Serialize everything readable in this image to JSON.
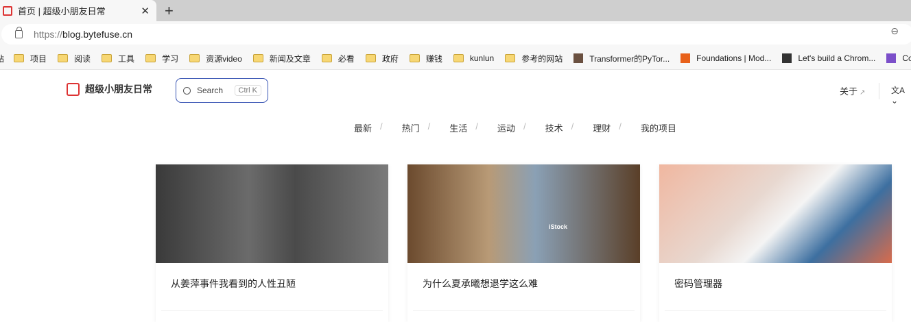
{
  "browser": {
    "tab_title": "首页 | 超级小朋友日常",
    "url_scheme": "https://",
    "url_host": "blog.bytefuse.cn",
    "bookmarks": [
      {
        "label": "项目",
        "type": "folder"
      },
      {
        "label": "阅读",
        "type": "folder"
      },
      {
        "label": "工具",
        "type": "folder"
      },
      {
        "label": "学习",
        "type": "folder"
      },
      {
        "label": "资源video",
        "type": "folder"
      },
      {
        "label": "新闻及文章",
        "type": "folder"
      },
      {
        "label": "必看",
        "type": "folder"
      },
      {
        "label": "政府",
        "type": "folder"
      },
      {
        "label": "赚钱",
        "type": "folder"
      },
      {
        "label": "kunlun",
        "type": "folder"
      },
      {
        "label": "参考的网站",
        "type": "folder"
      },
      {
        "label": "Transformer的PyTor...",
        "type": "link",
        "color": "#6a5040"
      },
      {
        "label": "Foundations | Mod...",
        "type": "link",
        "color": "#e8611a"
      },
      {
        "label": "Let's build a Chrom...",
        "type": "link",
        "color": "#333333"
      },
      {
        "label": "Co",
        "type": "link",
        "color": "#7b4fc9"
      }
    ]
  },
  "site": {
    "brand": "超级小朋友日常",
    "search_label": "Search",
    "search_kbd": "Ctrl K",
    "about": "关于",
    "about_arrow": "↗",
    "lang_icon": "文A ⌄",
    "nav": [
      "最新",
      "热门",
      "生活",
      "运动",
      "技术",
      "理财",
      "我的项目"
    ],
    "nav_separator": "/",
    "posts": [
      {
        "title": "从姜萍事件我看到的人性丑陋"
      },
      {
        "title": "为什么夏承曦想退学这么难",
        "watermark": "iStock"
      },
      {
        "title": "密码管理器"
      }
    ]
  },
  "colors": {
    "accent": "#3451b2",
    "brand": "#dd3333"
  }
}
